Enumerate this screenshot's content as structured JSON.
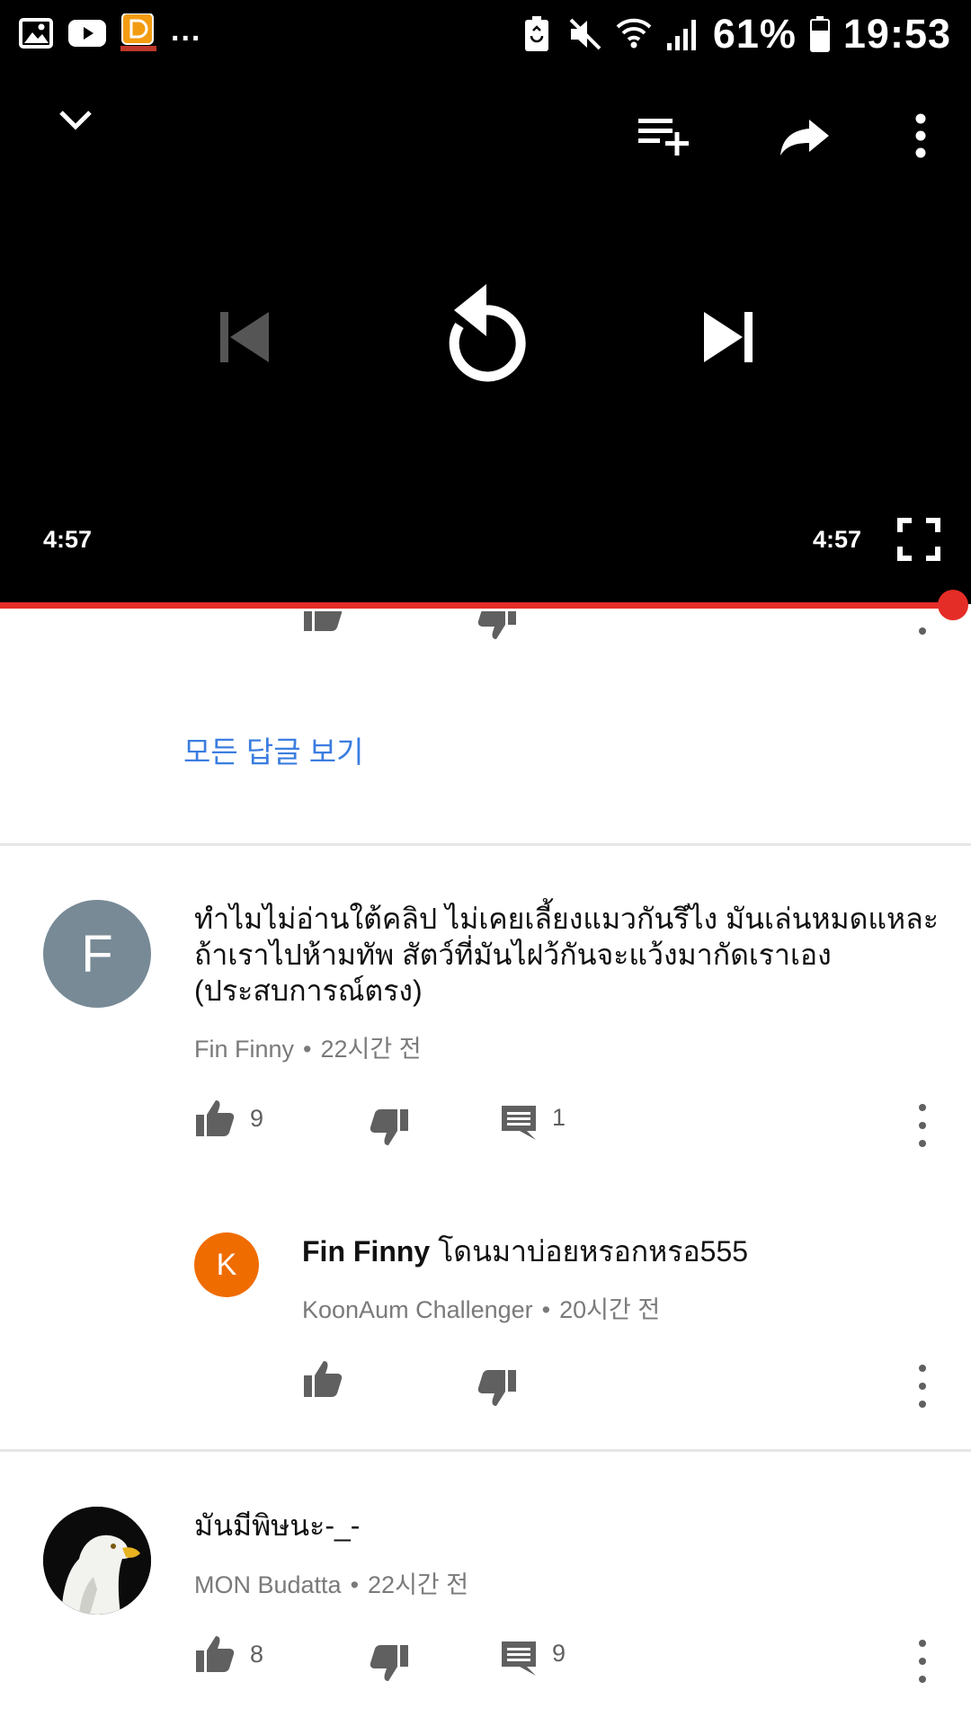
{
  "status_bar": {
    "overflow_indicator": "...",
    "battery_percent": "61%",
    "time": "19:53"
  },
  "player": {
    "current_time": "4:57",
    "duration": "4:57",
    "progress_fraction": 1.0,
    "accent_color": "#e52d27"
  },
  "previous_thread": {
    "view_all_replies": "모든 답글 보기"
  },
  "comments": [
    {
      "avatar_letter": "F",
      "avatar_color": "#778a96",
      "text_lines": [
        "ทำไมไม่อ่านใต้คลิป ไม่เคยเลี้ยงแมวกันรึไง มันเล่นหมดแหละ",
        "ถ้าเราไปห้ามทัพ สัตว์ที่มันไฝว้กันจะแว้งมากัดเราเอง",
        "(ประสบการณ์ตรง)"
      ],
      "author": "Fin Finny",
      "time": "22시간 전",
      "likes": "9",
      "replies": "1",
      "reply": {
        "avatar_letter": "K",
        "avatar_color": "#ef6c00",
        "mention": "Fin Finny",
        "text": " โดนมาบ่อยหรอกหรอ555",
        "author": "KoonAum Challenger",
        "time": "20시간 전"
      }
    },
    {
      "avatar_icon": "eagle-avatar",
      "text": "มันมีพิษนะ-_-",
      "author": "MON Budatta",
      "time": "22시간 전",
      "likes": "8",
      "replies": "9"
    }
  ],
  "icons": {
    "gallery": "image-icon",
    "youtube": "youtube-icon",
    "app": "app-icon",
    "battery_saver": "battery-saver-icon",
    "mute": "mute-icon",
    "wifi": "wifi-icon",
    "signal": "signal-icon",
    "battery": "battery-icon"
  }
}
